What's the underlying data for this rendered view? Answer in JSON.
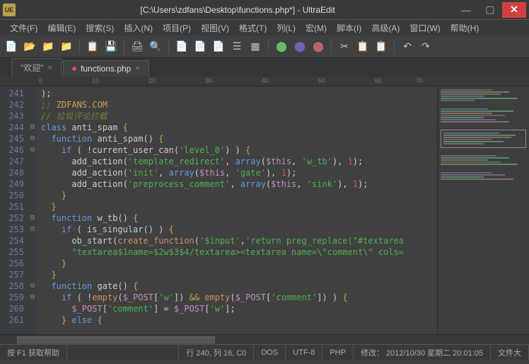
{
  "titlebar": {
    "path": "[C:\\Users\\zdfans\\Desktop\\functions.php*] - UltraEdit"
  },
  "menu": [
    "文件(F)",
    "编辑(E)",
    "搜索(S)",
    "插入(N)",
    "项目(P)",
    "视图(V)",
    "格式(T)",
    "列(L)",
    "宏(M)",
    "脚本(I)",
    "高级(A)",
    "窗口(W)",
    "帮助(H)"
  ],
  "tabs": [
    {
      "label": "\"欢迎\""
    },
    {
      "label": "functions.php"
    }
  ],
  "ruler": [
    "0",
    "10",
    "20",
    "30",
    "40",
    "50",
    "60",
    "70"
  ],
  "lines": [
    "241",
    "242",
    "243",
    "244",
    "245",
    "246",
    "247",
    "248",
    "249",
    "250",
    "251",
    "252",
    "253",
    "254",
    "255",
    "256",
    "257",
    "258",
    "259",
    "260",
    "261"
  ],
  "code": {
    "l241": ");",
    "l242a": ";; ",
    "l242b": "ZDFANS.COM",
    "l243": "// 垃圾评论拦截",
    "l244a": "class",
    "l244b": " anti_spam ",
    "l244c": "{",
    "l245a": "function",
    "l245b": " anti_spam() ",
    "l245c": "{",
    "l246a": "if",
    "l246b": " ( !current_user_can(",
    "l246c": "'level_0'",
    "l246d": ") )  ",
    "l246e": "{",
    "l247a": "add_action(",
    "l247b": "'template_redirect'",
    "l247c": ", ",
    "l247d": "array",
    "l247e": "(",
    "l247f": "$this",
    "l247g": ", ",
    "l247h": "'w_tb'",
    "l247i": "), ",
    "l247j": "1",
    "l247k": ");",
    "l248a": "add_action(",
    "l248b": "'init'",
    "l248c": ", ",
    "l248d": "array",
    "l248e": "(",
    "l248f": "$this",
    "l248g": ", ",
    "l248h": "'gate'",
    "l248i": "), ",
    "l248j": "1",
    "l248k": ");",
    "l249a": "add_action(",
    "l249b": "'preprocess_comment'",
    "l249c": ", ",
    "l249d": "array",
    "l249e": "(",
    "l249f": "$this",
    "l249g": ", ",
    "l249h": "'sink'",
    "l249i": "), ",
    "l249j": "1",
    "l249k": ");",
    "l250": "}",
    "l251": "}",
    "l252a": "function",
    "l252b": " w_tb() ",
    "l252c": "{",
    "l253a": "if",
    "l253b": " ( is_singular() )  ",
    "l253c": "{",
    "l254a": "ob_start(",
    "l254b": "create_function",
    "l254c": "(",
    "l254d": "'$input'",
    "l254e": ",",
    "l254f": "'return preg_replace(\"#textarea",
    "l255": "\"textarea$1name=$2w$3$4/textarea><textarea name=\\\"comment\\\" cols=",
    "l256": "}",
    "l257": "}",
    "l258a": "function",
    "l258b": " gate() ",
    "l258c": "{",
    "l259a": "if",
    "l259b": " ( !",
    "l259c": "empty",
    "l259d": "(",
    "l259e": "$_POST",
    "l259f": "[",
    "l259g": "'w'",
    "l259h": "]) ",
    "l259i": "&&",
    "l259j": " ",
    "l259k": "empty",
    "l259l": "(",
    "l259m": "$_POST",
    "l259n": "[",
    "l259o": "'comment'",
    "l259p": "]) )  ",
    "l259q": "{",
    "l260a": "$_POST",
    "l260b": "[",
    "l260c": "'comment'",
    "l260d": "] = ",
    "l260e": "$_POST",
    "l260f": "[",
    "l260g": "'w'",
    "l260h": "];",
    "l261a": "} ",
    "l261b": "else",
    "l261c": " {"
  },
  "status": {
    "help": "按 F1 获取帮助",
    "pos": "行 240, 列 16, C0",
    "enc1": "DOS",
    "enc2": "UTF-8",
    "lang": "PHP",
    "mod": "修改：  2012/10/30 星期二 20:01:05",
    "size": "文件大"
  }
}
